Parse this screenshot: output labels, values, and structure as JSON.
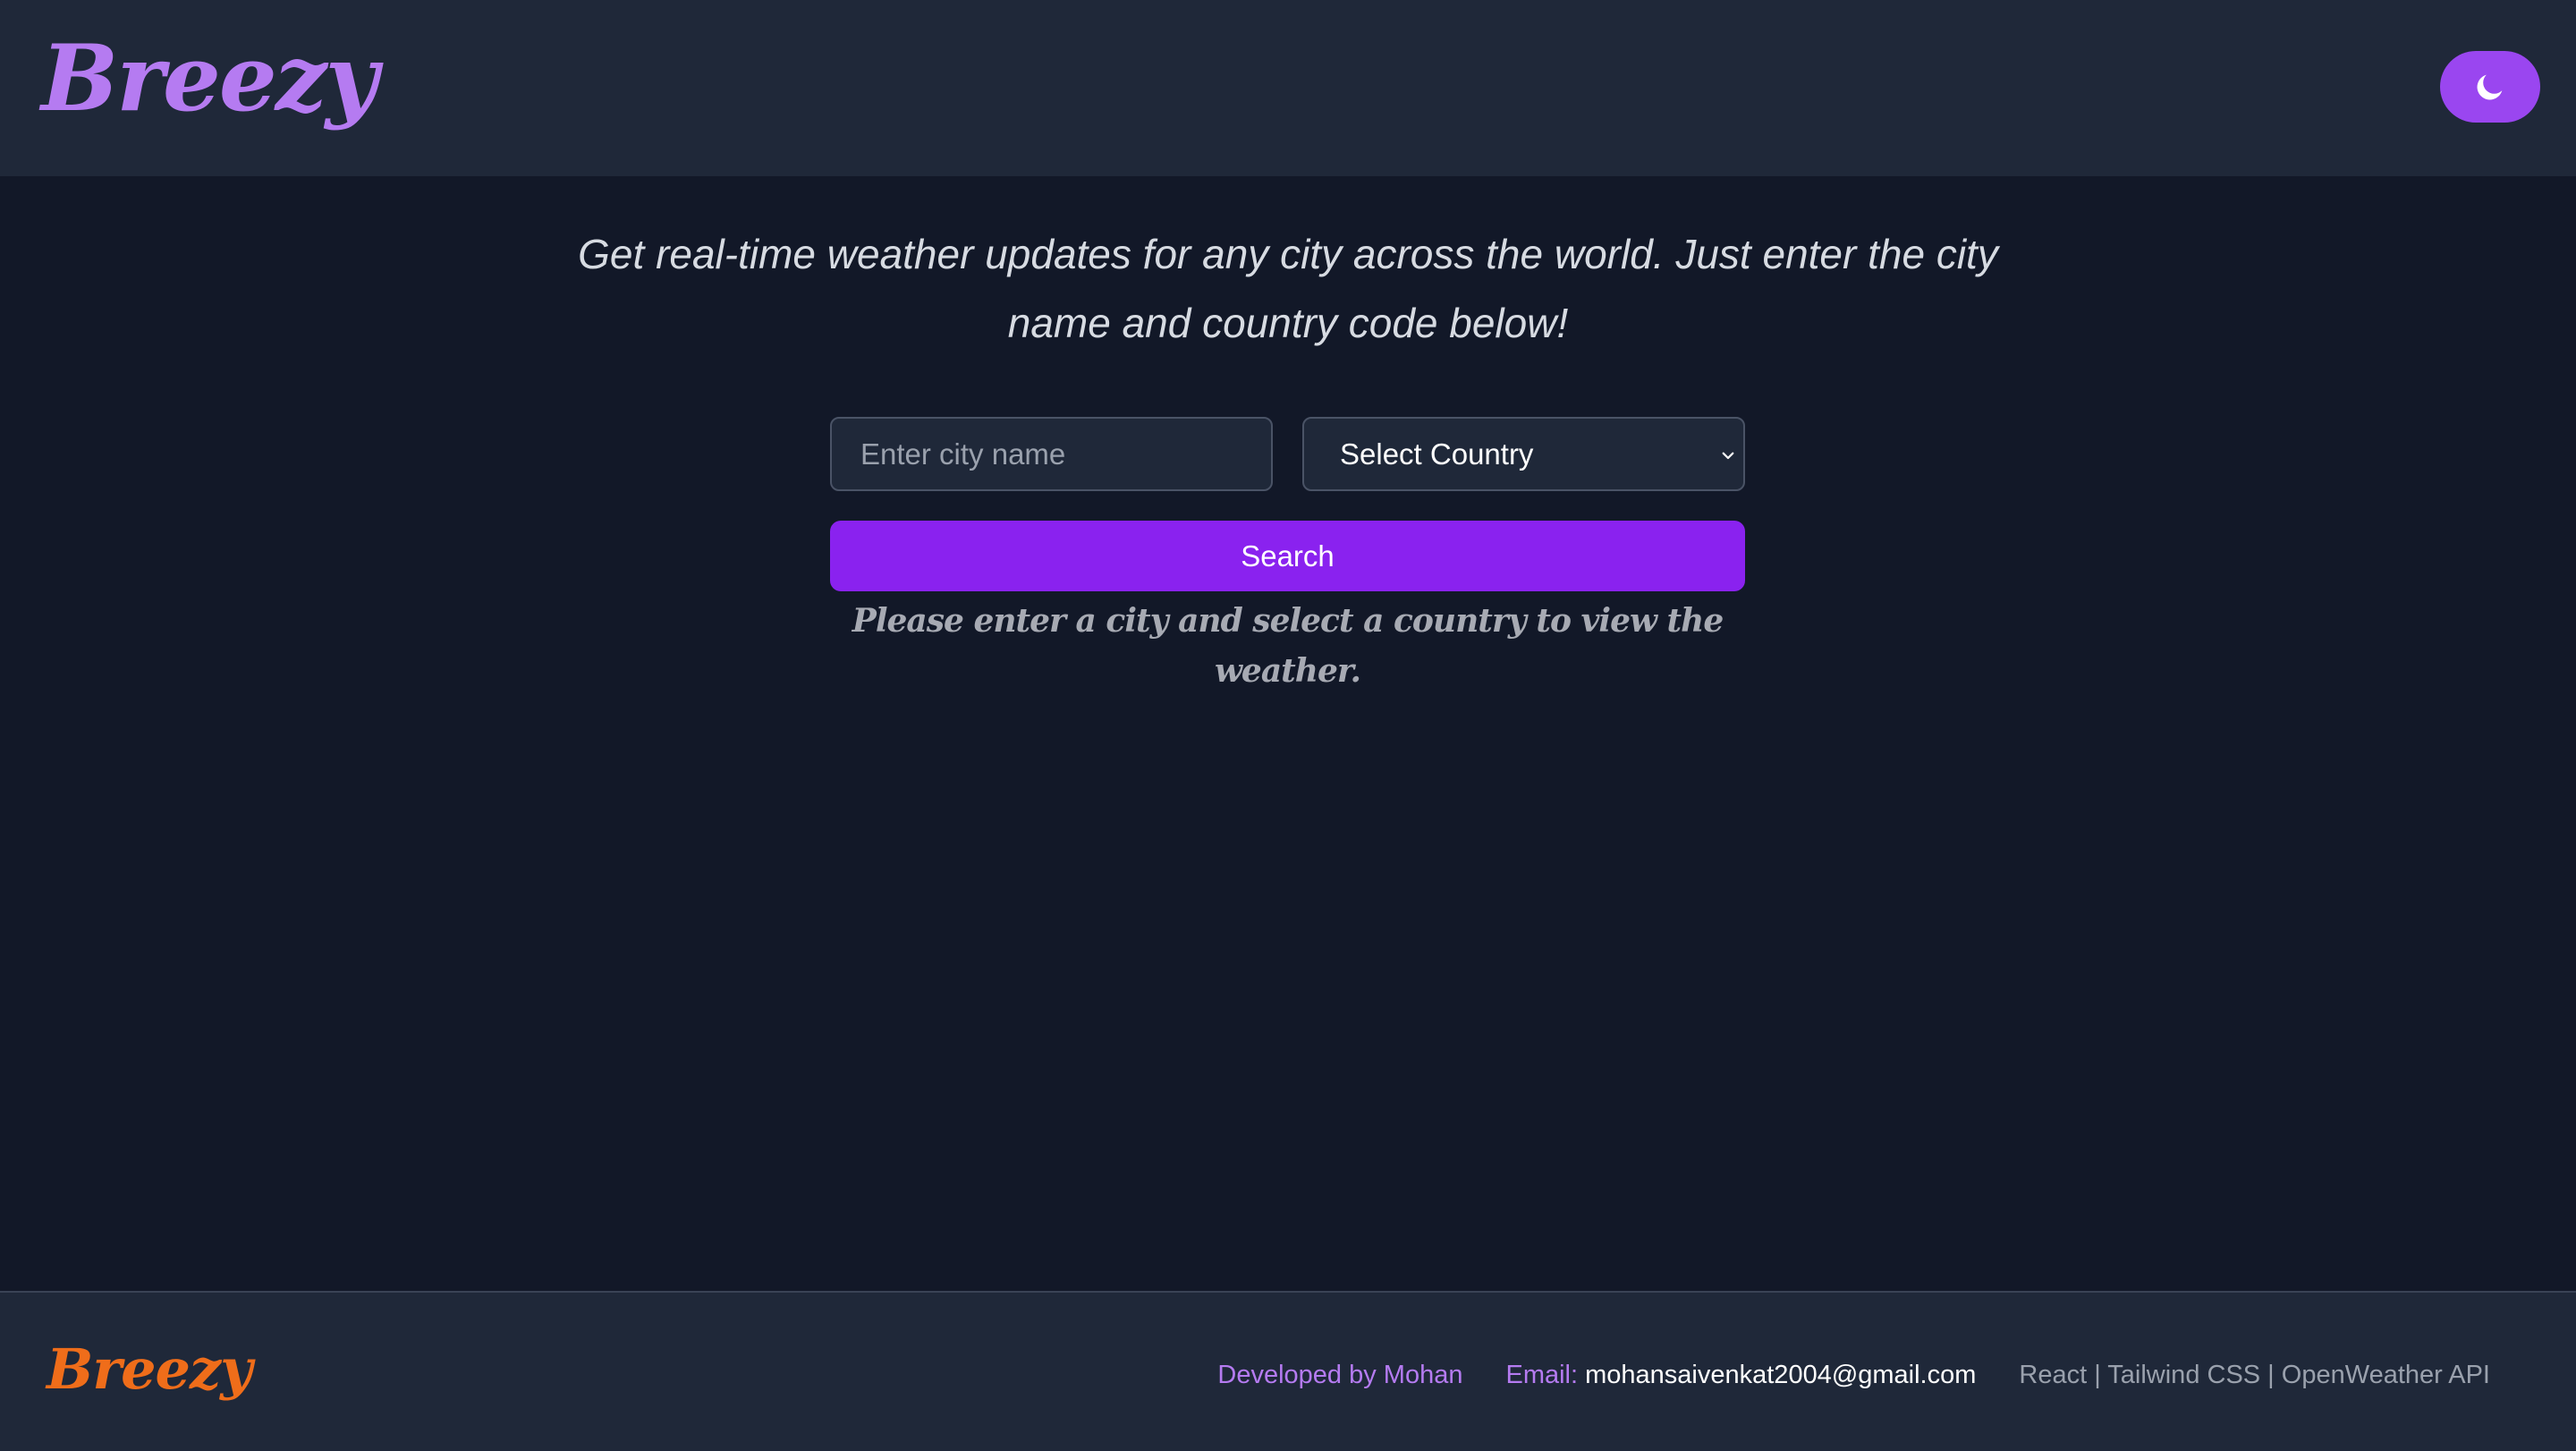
{
  "header": {
    "logo": "Breezy",
    "theme_toggle_icon": "moon-icon"
  },
  "main": {
    "tagline": "Get real-time weather updates for any city across the world. Just enter the city name and country code below!",
    "city_input": {
      "placeholder": "Enter city name",
      "value": ""
    },
    "country_select": {
      "selected": "Select Country"
    },
    "search_button": "Search",
    "hint": "Please enter a city and select a country to view the weather."
  },
  "footer": {
    "logo": "Breezy",
    "developer": "Developed by Mohan",
    "email_label": "Email:",
    "email_value": "mohansaivenkat2004@gmail.com",
    "stack": "React | Tailwind CSS | OpenWeather API"
  },
  "colors": {
    "accent": "#8a22ef",
    "logo": "#b57bf1",
    "footer_logo": "#ef6d1a",
    "background": "#121828",
    "surface": "#1f2839"
  }
}
